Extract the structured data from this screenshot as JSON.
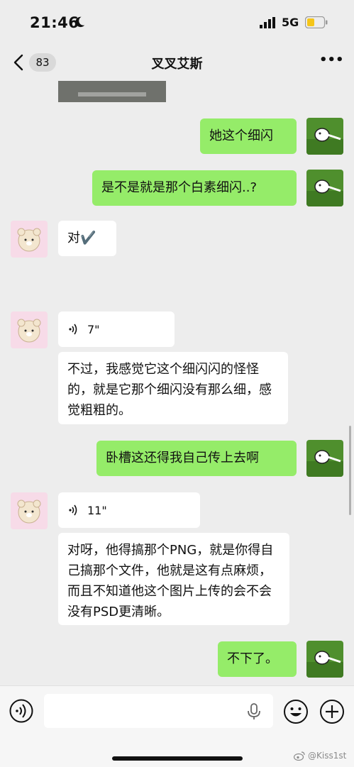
{
  "status_bar": {
    "time": "21:46",
    "network": "5G",
    "icons": [
      "moon-icon",
      "signal-icon",
      "battery-icon"
    ],
    "battery_color": "#f5c518"
  },
  "nav": {
    "unread_count": "83",
    "title": "叉叉艾斯",
    "icons": [
      "back-arrow-icon",
      "more-icon"
    ]
  },
  "messages": [
    {
      "sender": "me",
      "type": "text",
      "text": "她这个细闪"
    },
    {
      "sender": "me",
      "type": "text",
      "text": "是不是就是那个白素细闪..?"
    },
    {
      "sender": "other",
      "type": "text",
      "text": "对✔️"
    },
    {
      "sender": "other",
      "type": "voice",
      "duration": "7\""
    },
    {
      "sender": "other",
      "type": "text",
      "text": "不过，我感觉它这个细闪闪的怪怪的，就是它那个细闪没有那么细，感觉粗粗的。"
    },
    {
      "sender": "me",
      "type": "text",
      "text": "卧槽这还得我自己传上去啊"
    },
    {
      "sender": "other",
      "type": "voice",
      "duration": "11\""
    },
    {
      "sender": "other",
      "type": "text",
      "text": "对呀，他得搞那个PNG，就是你得自己搞那个文件，他就是这有点麻烦，而且不知道他这个图片上传的会不会没有PSD更清晰。"
    },
    {
      "sender": "me",
      "type": "text",
      "text": "不下了。"
    }
  ],
  "input_bar": {
    "placeholder": "",
    "icons": [
      "voice-mode-icon",
      "microphone-icon",
      "emoji-icon",
      "plus-icon"
    ]
  },
  "watermark": "@Kiss1st",
  "colors": {
    "my_bubble": "#95ec69",
    "other_bubble": "#ffffff",
    "background": "#ededed"
  }
}
